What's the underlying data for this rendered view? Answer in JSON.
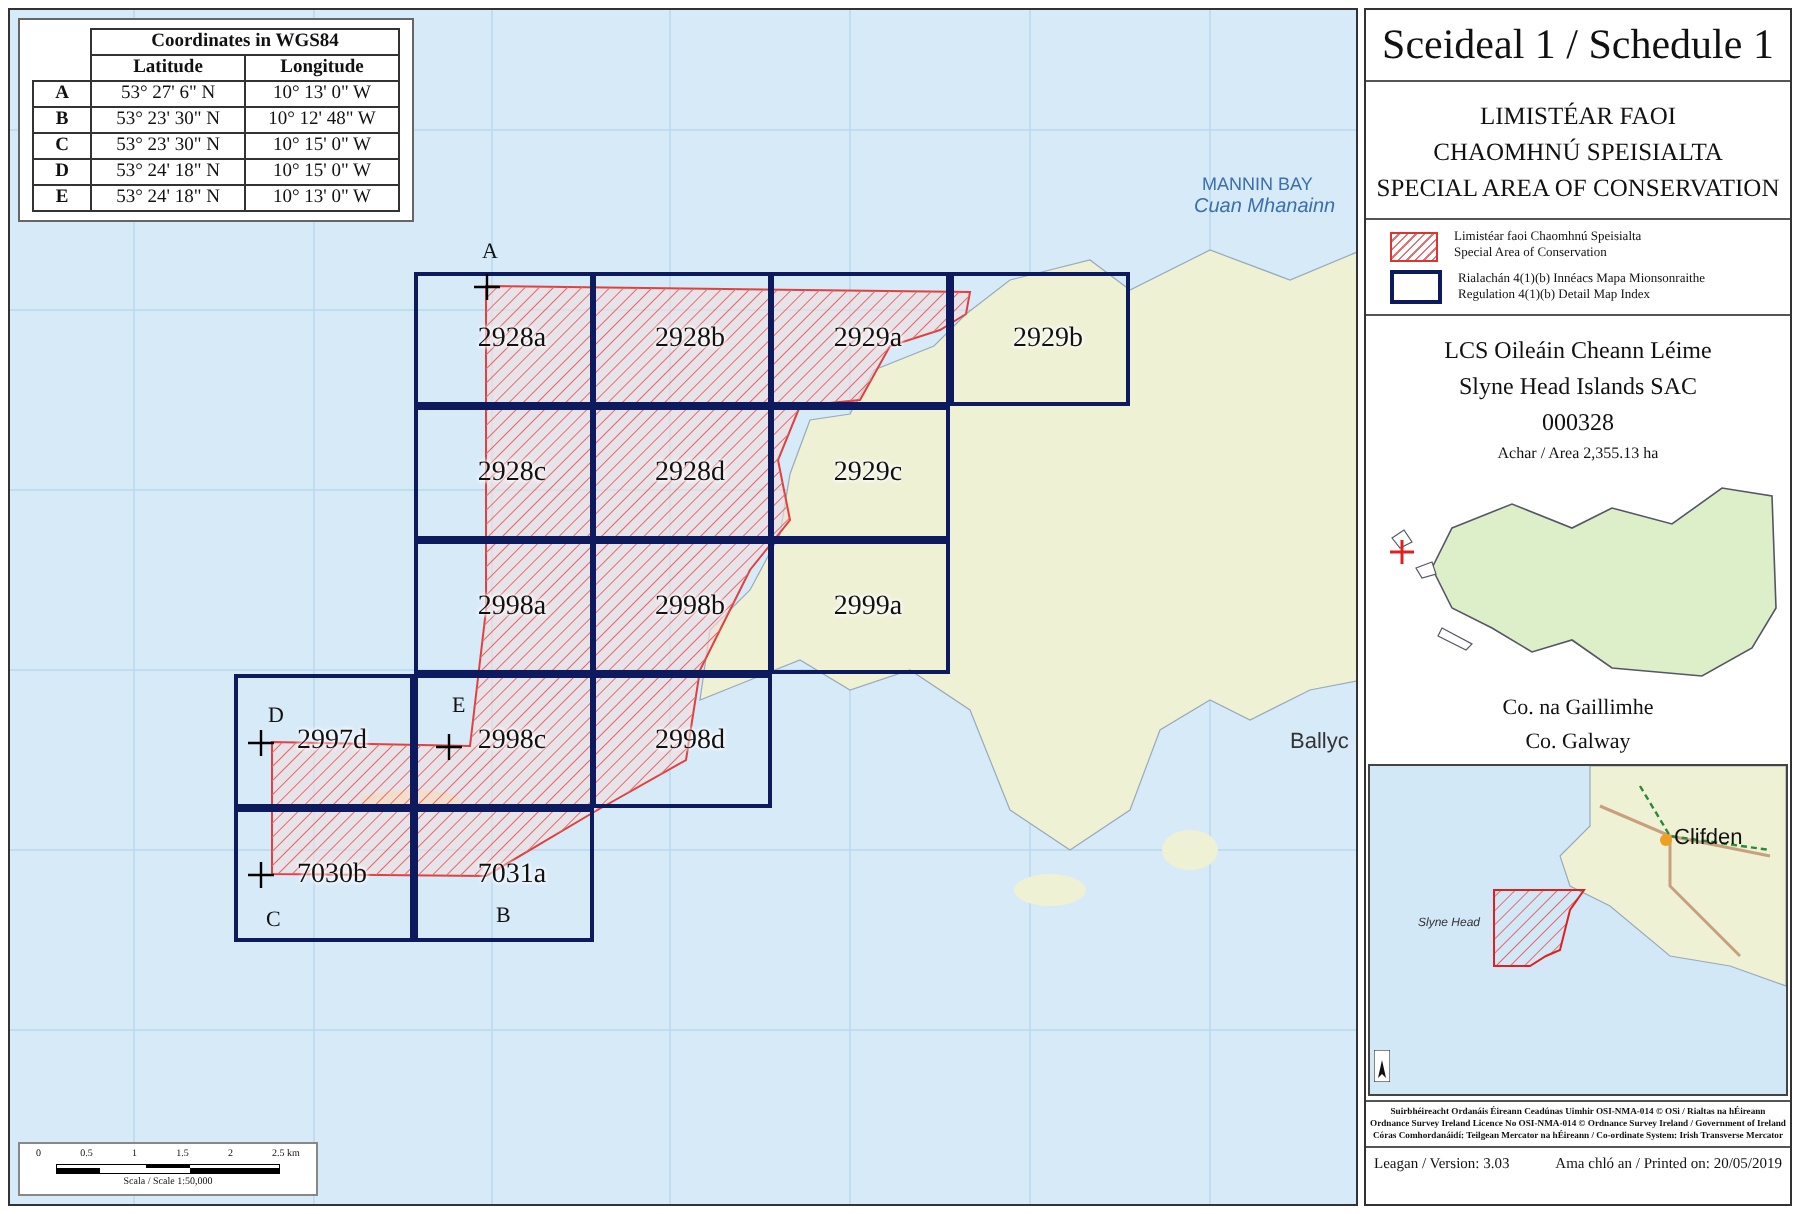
{
  "coordinates_table": {
    "title": "Coordinates in WGS84",
    "columns": [
      "Latitude",
      "Longitude"
    ],
    "rows": [
      {
        "point": "A",
        "latitude": "53° 27' 6\" N",
        "longitude": "10° 13' 0\" W"
      },
      {
        "point": "B",
        "latitude": "53° 23' 30\" N",
        "longitude": "10° 12' 48\" W"
      },
      {
        "point": "C",
        "latitude": "53° 23' 30\" N",
        "longitude": "10° 15' 0\" W"
      },
      {
        "point": "D",
        "latitude": "53° 24' 18\" N",
        "longitude": "10° 15' 0\" W"
      },
      {
        "point": "E",
        "latitude": "53° 24' 18\" N",
        "longitude": "10° 13' 0\" W"
      }
    ]
  },
  "map": {
    "water_labels": [
      "MANNIN BAY",
      "Cuan Mhanainn"
    ],
    "place_labels": [
      "Ballyc"
    ],
    "tile_rows": [
      {
        "tiles": [
          "2928a",
          "2928b",
          "2929a",
          "2929b"
        ]
      },
      {
        "tiles": [
          "2928c",
          "2928d",
          "2929c"
        ]
      },
      {
        "tiles": [
          "2998a",
          "2998b",
          "2999a"
        ]
      },
      {
        "tiles": [
          "2997d",
          "2998c",
          "2998d"
        ]
      },
      {
        "tiles": [
          "7030b",
          "7031a"
        ]
      }
    ],
    "points": [
      "A",
      "B",
      "C",
      "D",
      "E"
    ],
    "scale_bar": {
      "ticks": [
        "0",
        "0.5",
        "1",
        "1.5",
        "2",
        "2.5 km"
      ],
      "caption": "Scala / Scale 1:50,000"
    }
  },
  "panel": {
    "title": "Sceideal 1 / Schedule 1",
    "designation": [
      "LIMISTÉAR FAOI",
      "CHAOMHNÚ SPEISIALTA",
      "SPECIAL AREA OF CONSERVATION"
    ],
    "legend": [
      {
        "kind": "hatch",
        "lines": [
          "Limistéar faoi Chaomhnú Speisialta",
          "Special Area of Conservation"
        ]
      },
      {
        "kind": "outline",
        "lines": [
          "Rialachán 4(1)(b) Innéacs Mapa Mionsonraithe",
          "Regulation 4(1)(b) Detail Map Index"
        ]
      }
    ],
    "site": {
      "name_irish": "LCS Oileáin Cheann Léime",
      "name_english": "Slyne Head Islands SAC",
      "code": "000328",
      "area": "Achar / Area 2,355.13 ha"
    },
    "county": [
      "Co. na Gaillimhe",
      "Co. Galway"
    ],
    "inset_labels": [
      "Clifden",
      "Slyne Head"
    ],
    "credits": [
      "Suirbhéireacht Ordanáis Éireann Ceadúnas Uimhir OSI-NMA-014 © OSi / Rialtas na hÉireann",
      "Ordnance Survey Ireland Licence No OSI-NMA-014 © Ordnance Survey Ireland / Government of Ireland",
      "Córas Comhordanáidí: Teilgean Mercator na hÉireann / Co-ordinate System: Irish Transverse Mercator"
    ],
    "version": "Leagan / Version: 3.03",
    "printed": "Ama chló an / Printed on: 20/05/2019"
  }
}
